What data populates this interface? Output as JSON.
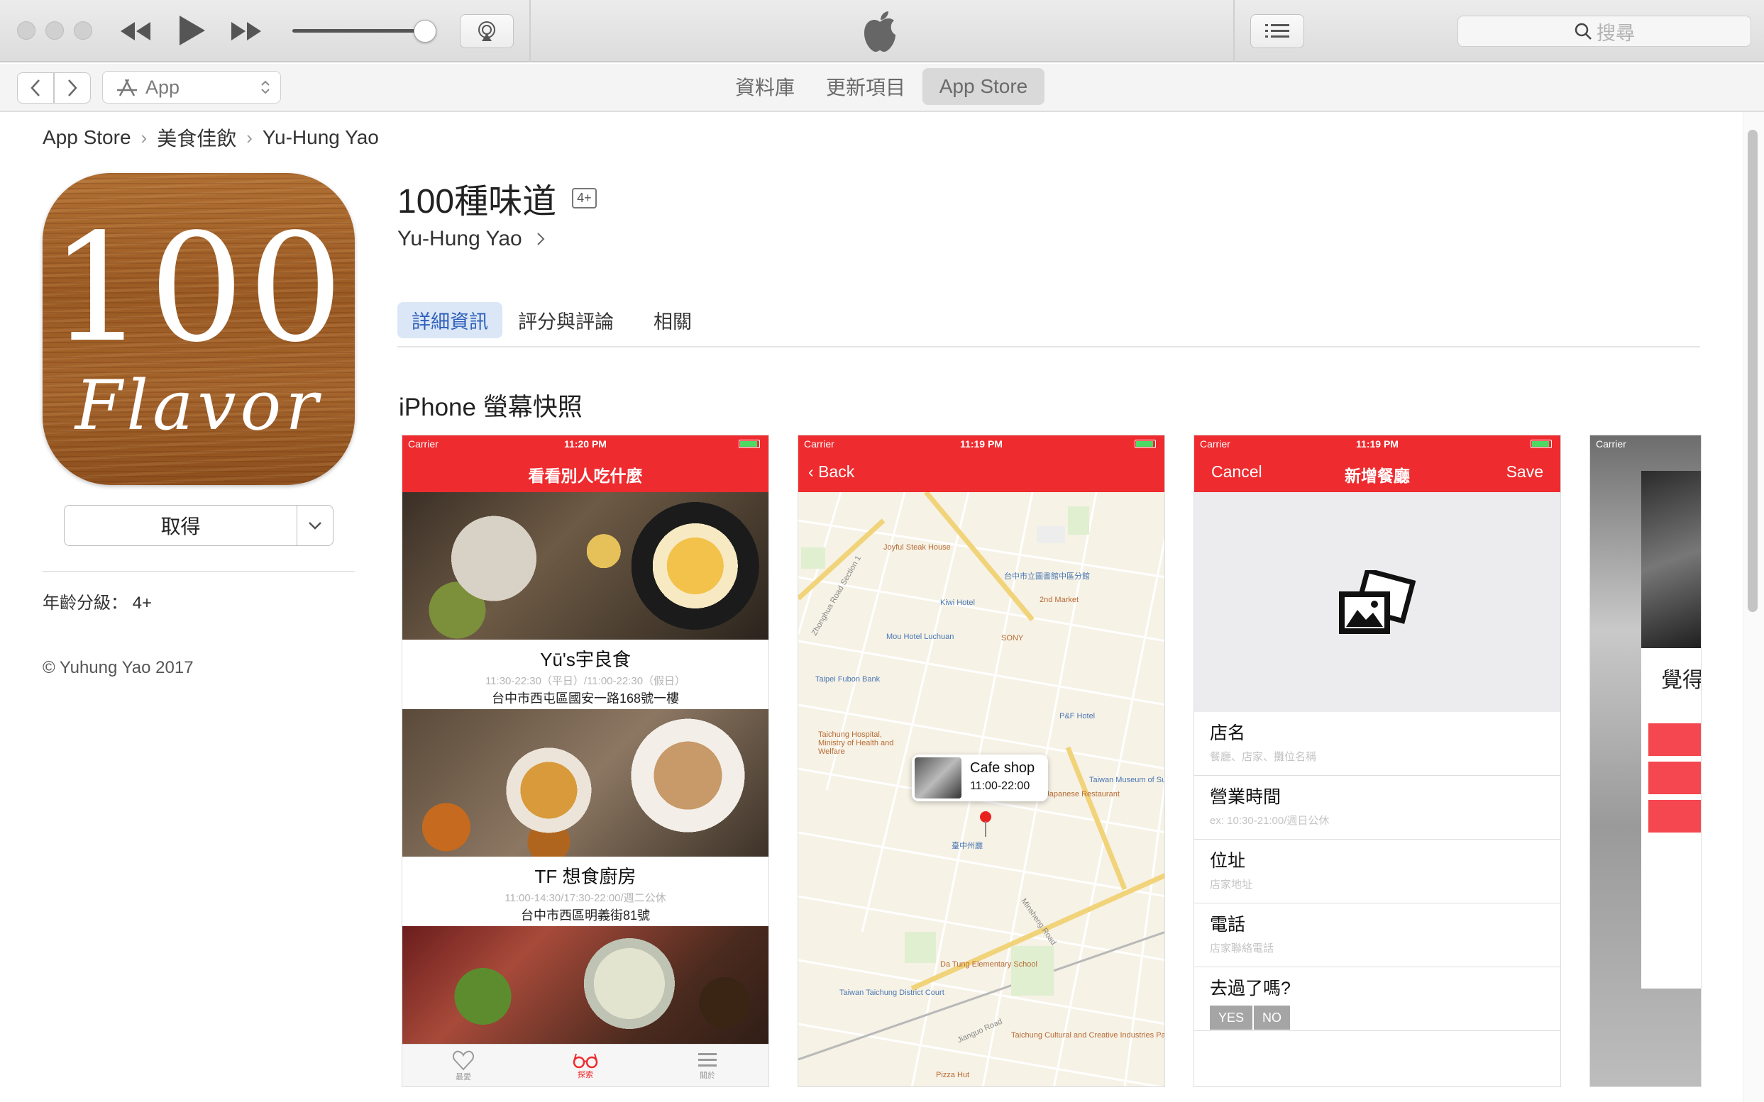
{
  "toolbar": {
    "search_placeholder": "搜尋"
  },
  "navbar": {
    "app_select": "App",
    "tabs": [
      "資料庫",
      "更新項目",
      "App Store"
    ],
    "active_tab": "App Store"
  },
  "breadcrumb": [
    "App Store",
    "美食佳飲",
    "Yu-Hung Yao"
  ],
  "app": {
    "title": "100種味道",
    "age_badge": "4+",
    "developer": "Yu-Hung Yao",
    "icon_top": "100",
    "icon_bottom": "Flavor",
    "get_label": "取得",
    "age_rating": "年齡分級：  4+",
    "copyright": "© Yuhung Yao 2017"
  },
  "tabs": [
    "詳細資訊",
    "評分與評論",
    "相關"
  ],
  "active_tab": "詳細資訊",
  "screenshots_title": "iPhone 螢幕快照",
  "shot1": {
    "carrier": "Carrier",
    "time": "11:20 PM",
    "title": "看看別人吃什麼",
    "items": [
      {
        "name": "Yū's宇良食",
        "hours": "11:30-22:30（平日）/11:00-22:30（假日）",
        "address": "台中市西屯區國安一路168號一樓"
      },
      {
        "name": "TF 想食廚房",
        "hours": "11:00-14:30/17:30-22:00/週二公休",
        "address": "台中市西區明義街81號"
      }
    ],
    "tabbar": [
      "最愛",
      "探索",
      "關於"
    ]
  },
  "shot2": {
    "carrier": "Carrier",
    "time": "11:19 PM",
    "back": "Back",
    "callout_title": "Cafe shop",
    "callout_hours": "11:00-22:00",
    "labels": [
      "Joyful Steak House",
      "台中市立圖書館中區分館",
      "Kiwi Hotel",
      "2nd Market",
      "SONY",
      "Mou Hotel Luchuan",
      "Taipei Fubon Bank",
      "Taichung Hospital, Ministry of Health and Welfare",
      "Shui Che Japanese Restaurant",
      "Taiwan Museum of Suncake",
      "P&F Hotel",
      "臺中州廳",
      "Da Tung Elementary School",
      "Taiwan Taichung District Court",
      "Taichung Cultural and Creative Industries Park",
      "Pizza Hut",
      "Jianguo Road",
      "Minsheng Road",
      "Zhonghua Road Section 1"
    ]
  },
  "shot3": {
    "carrier": "Carrier",
    "time": "11:19 PM",
    "cancel": "Cancel",
    "title": "新增餐廳",
    "save": "Save",
    "fields": [
      {
        "label": "店名",
        "placeholder": "餐廳、店家、攤位名稱"
      },
      {
        "label": "營業時間",
        "placeholder": "ex: 10:30-21:00/週日公休"
      },
      {
        "label": "位址",
        "placeholder": "店家地址"
      },
      {
        "label": "電話",
        "placeholder": "店家聯絡電話"
      },
      {
        "label": "去過了嗎?",
        "placeholder": ""
      }
    ],
    "yes": "YES",
    "no": "NO"
  },
  "shot4": {
    "carrier": "Carrier",
    "partial_text": "覺得"
  }
}
